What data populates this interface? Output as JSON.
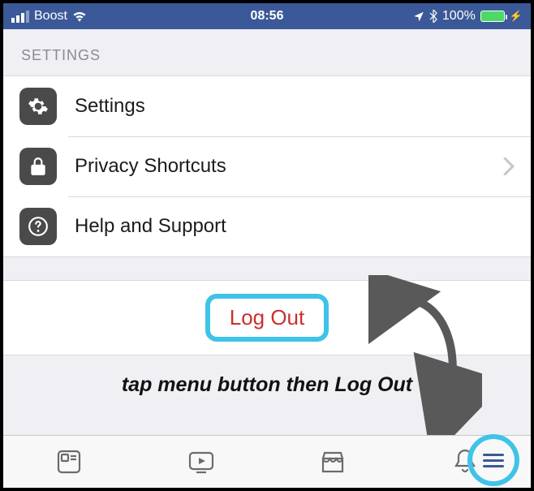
{
  "status": {
    "carrier": "Boost",
    "time": "08:56",
    "battery_pct": "100%"
  },
  "section": {
    "title": "SETTINGS"
  },
  "rows": {
    "settings": "Settings",
    "privacy": "Privacy Shortcuts",
    "help": "Help and Support"
  },
  "logout": {
    "label": "Log Out"
  },
  "caption": "tap menu button then Log Out"
}
